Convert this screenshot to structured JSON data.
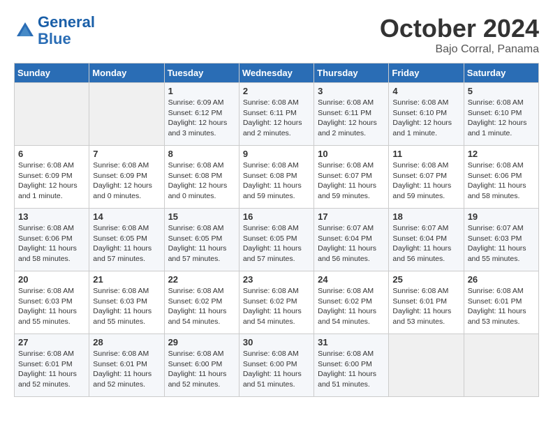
{
  "header": {
    "logo_line1": "General",
    "logo_line2": "Blue",
    "month": "October 2024",
    "location": "Bajo Corral, Panama"
  },
  "weekdays": [
    "Sunday",
    "Monday",
    "Tuesday",
    "Wednesday",
    "Thursday",
    "Friday",
    "Saturday"
  ],
  "weeks": [
    [
      {
        "day": "",
        "info": ""
      },
      {
        "day": "",
        "info": ""
      },
      {
        "day": "1",
        "info": "Sunrise: 6:09 AM\nSunset: 6:12 PM\nDaylight: 12 hours and 3 minutes."
      },
      {
        "day": "2",
        "info": "Sunrise: 6:08 AM\nSunset: 6:11 PM\nDaylight: 12 hours and 2 minutes."
      },
      {
        "day": "3",
        "info": "Sunrise: 6:08 AM\nSunset: 6:11 PM\nDaylight: 12 hours and 2 minutes."
      },
      {
        "day": "4",
        "info": "Sunrise: 6:08 AM\nSunset: 6:10 PM\nDaylight: 12 hours and 1 minute."
      },
      {
        "day": "5",
        "info": "Sunrise: 6:08 AM\nSunset: 6:10 PM\nDaylight: 12 hours and 1 minute."
      }
    ],
    [
      {
        "day": "6",
        "info": "Sunrise: 6:08 AM\nSunset: 6:09 PM\nDaylight: 12 hours and 1 minute."
      },
      {
        "day": "7",
        "info": "Sunrise: 6:08 AM\nSunset: 6:09 PM\nDaylight: 12 hours and 0 minutes."
      },
      {
        "day": "8",
        "info": "Sunrise: 6:08 AM\nSunset: 6:08 PM\nDaylight: 12 hours and 0 minutes."
      },
      {
        "day": "9",
        "info": "Sunrise: 6:08 AM\nSunset: 6:08 PM\nDaylight: 11 hours and 59 minutes."
      },
      {
        "day": "10",
        "info": "Sunrise: 6:08 AM\nSunset: 6:07 PM\nDaylight: 11 hours and 59 minutes."
      },
      {
        "day": "11",
        "info": "Sunrise: 6:08 AM\nSunset: 6:07 PM\nDaylight: 11 hours and 59 minutes."
      },
      {
        "day": "12",
        "info": "Sunrise: 6:08 AM\nSunset: 6:06 PM\nDaylight: 11 hours and 58 minutes."
      }
    ],
    [
      {
        "day": "13",
        "info": "Sunrise: 6:08 AM\nSunset: 6:06 PM\nDaylight: 11 hours and 58 minutes."
      },
      {
        "day": "14",
        "info": "Sunrise: 6:08 AM\nSunset: 6:05 PM\nDaylight: 11 hours and 57 minutes."
      },
      {
        "day": "15",
        "info": "Sunrise: 6:08 AM\nSunset: 6:05 PM\nDaylight: 11 hours and 57 minutes."
      },
      {
        "day": "16",
        "info": "Sunrise: 6:08 AM\nSunset: 6:05 PM\nDaylight: 11 hours and 57 minutes."
      },
      {
        "day": "17",
        "info": "Sunrise: 6:07 AM\nSunset: 6:04 PM\nDaylight: 11 hours and 56 minutes."
      },
      {
        "day": "18",
        "info": "Sunrise: 6:07 AM\nSunset: 6:04 PM\nDaylight: 11 hours and 56 minutes."
      },
      {
        "day": "19",
        "info": "Sunrise: 6:07 AM\nSunset: 6:03 PM\nDaylight: 11 hours and 55 minutes."
      }
    ],
    [
      {
        "day": "20",
        "info": "Sunrise: 6:08 AM\nSunset: 6:03 PM\nDaylight: 11 hours and 55 minutes."
      },
      {
        "day": "21",
        "info": "Sunrise: 6:08 AM\nSunset: 6:03 PM\nDaylight: 11 hours and 55 minutes."
      },
      {
        "day": "22",
        "info": "Sunrise: 6:08 AM\nSunset: 6:02 PM\nDaylight: 11 hours and 54 minutes."
      },
      {
        "day": "23",
        "info": "Sunrise: 6:08 AM\nSunset: 6:02 PM\nDaylight: 11 hours and 54 minutes."
      },
      {
        "day": "24",
        "info": "Sunrise: 6:08 AM\nSunset: 6:02 PM\nDaylight: 11 hours and 54 minutes."
      },
      {
        "day": "25",
        "info": "Sunrise: 6:08 AM\nSunset: 6:01 PM\nDaylight: 11 hours and 53 minutes."
      },
      {
        "day": "26",
        "info": "Sunrise: 6:08 AM\nSunset: 6:01 PM\nDaylight: 11 hours and 53 minutes."
      }
    ],
    [
      {
        "day": "27",
        "info": "Sunrise: 6:08 AM\nSunset: 6:01 PM\nDaylight: 11 hours and 52 minutes."
      },
      {
        "day": "28",
        "info": "Sunrise: 6:08 AM\nSunset: 6:01 PM\nDaylight: 11 hours and 52 minutes."
      },
      {
        "day": "29",
        "info": "Sunrise: 6:08 AM\nSunset: 6:00 PM\nDaylight: 11 hours and 52 minutes."
      },
      {
        "day": "30",
        "info": "Sunrise: 6:08 AM\nSunset: 6:00 PM\nDaylight: 11 hours and 51 minutes."
      },
      {
        "day": "31",
        "info": "Sunrise: 6:08 AM\nSunset: 6:00 PM\nDaylight: 11 hours and 51 minutes."
      },
      {
        "day": "",
        "info": ""
      },
      {
        "day": "",
        "info": ""
      }
    ]
  ]
}
